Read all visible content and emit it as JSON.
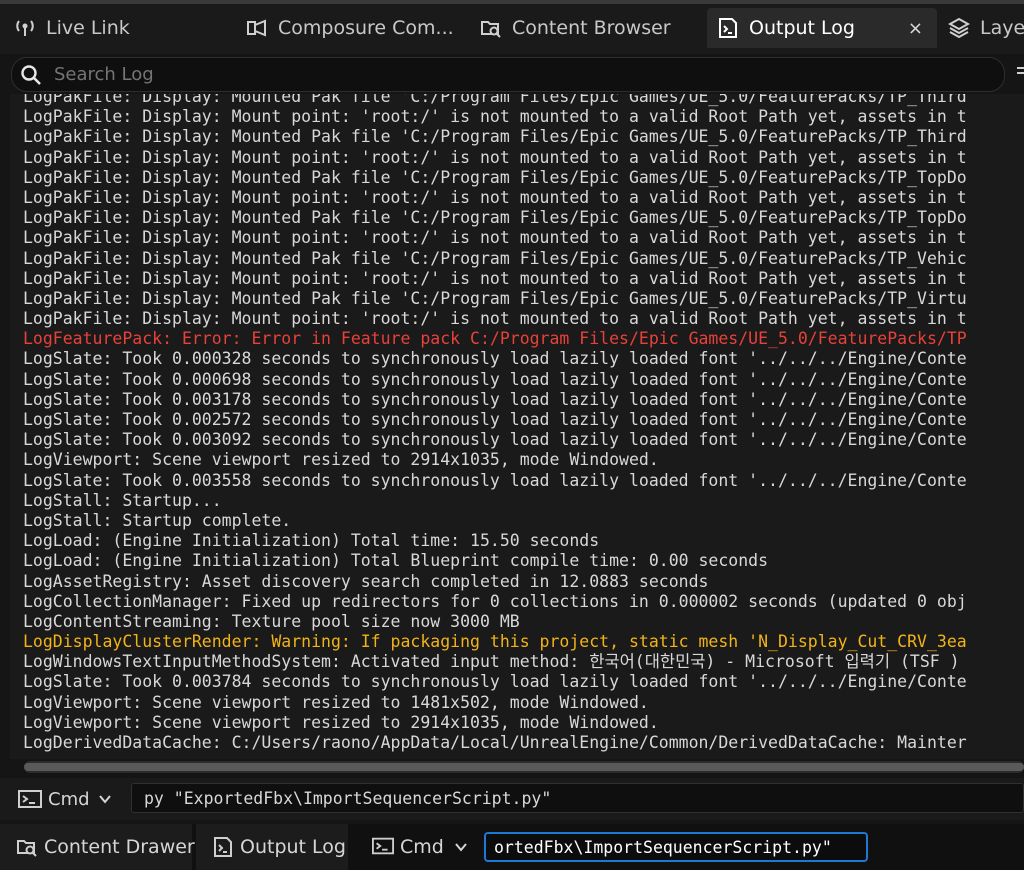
{
  "tabs": [
    {
      "label": "Live Link",
      "icon": "live-link-icon",
      "active": false
    },
    {
      "label": "Composure Com...",
      "icon": "composure-icon",
      "active": false
    },
    {
      "label": "Content Browser",
      "icon": "content-browser-icon",
      "active": false
    },
    {
      "label": "Output Log",
      "icon": "output-log-icon",
      "active": true
    },
    {
      "label": "Layer",
      "icon": "layers-icon",
      "active": false
    }
  ],
  "tab_close": "×",
  "search": {
    "placeholder": "Search Log"
  },
  "log_lines": [
    {
      "text": "LogPakFile: Display: Mounted Pak file 'C:/Program Files/Epic Games/UE_5.0/FeaturePacks/TP_Third",
      "level": "normal"
    },
    {
      "text": "LogPakFile: Display: Mount point: 'root:/' is not mounted to a valid Root Path yet, assets in t",
      "level": "normal"
    },
    {
      "text": "LogPakFile: Display: Mounted Pak file 'C:/Program Files/Epic Games/UE_5.0/FeaturePacks/TP_Third",
      "level": "normal"
    },
    {
      "text": "LogPakFile: Display: Mount point: 'root:/' is not mounted to a valid Root Path yet, assets in t",
      "level": "normal"
    },
    {
      "text": "LogPakFile: Display: Mounted Pak file 'C:/Program Files/Epic Games/UE_5.0/FeaturePacks/TP_TopDo",
      "level": "normal"
    },
    {
      "text": "LogPakFile: Display: Mount point: 'root:/' is not mounted to a valid Root Path yet, assets in t",
      "level": "normal"
    },
    {
      "text": "LogPakFile: Display: Mounted Pak file 'C:/Program Files/Epic Games/UE_5.0/FeaturePacks/TP_TopDo",
      "level": "normal"
    },
    {
      "text": "LogPakFile: Display: Mount point: 'root:/' is not mounted to a valid Root Path yet, assets in t",
      "level": "normal"
    },
    {
      "text": "LogPakFile: Display: Mounted Pak file 'C:/Program Files/Epic Games/UE_5.0/FeaturePacks/TP_Vehic",
      "level": "normal"
    },
    {
      "text": "LogPakFile: Display: Mount point: 'root:/' is not mounted to a valid Root Path yet, assets in t",
      "level": "normal"
    },
    {
      "text": "LogPakFile: Display: Mounted Pak file 'C:/Program Files/Epic Games/UE_5.0/FeaturePacks/TP_Virtu",
      "level": "normal"
    },
    {
      "text": "LogPakFile: Display: Mount point: 'root:/' is not mounted to a valid Root Path yet, assets in t",
      "level": "normal"
    },
    {
      "text": "LogFeaturePack: Error: Error in Feature pack C:/Program Files/Epic Games/UE_5.0/FeaturePacks/TP",
      "level": "error"
    },
    {
      "text": "LogSlate: Took 0.000328 seconds to synchronously load lazily loaded font '../../../Engine/Conte",
      "level": "normal"
    },
    {
      "text": "LogSlate: Took 0.000698 seconds to synchronously load lazily loaded font '../../../Engine/Conte",
      "level": "normal"
    },
    {
      "text": "LogSlate: Took 0.003178 seconds to synchronously load lazily loaded font '../../../Engine/Conte",
      "level": "normal"
    },
    {
      "text": "LogSlate: Took 0.002572 seconds to synchronously load lazily loaded font '../../../Engine/Conte",
      "level": "normal"
    },
    {
      "text": "LogSlate: Took 0.003092 seconds to synchronously load lazily loaded font '../../../Engine/Conte",
      "level": "normal"
    },
    {
      "text": "LogViewport: Scene viewport resized to 2914x1035, mode Windowed.",
      "level": "normal"
    },
    {
      "text": "LogSlate: Took 0.003558 seconds to synchronously load lazily loaded font '../../../Engine/Conte",
      "level": "normal"
    },
    {
      "text": "LogStall: Startup...",
      "level": "normal"
    },
    {
      "text": "LogStall: Startup complete.",
      "level": "normal"
    },
    {
      "text": "LogLoad: (Engine Initialization) Total time: 15.50 seconds",
      "level": "normal"
    },
    {
      "text": "LogLoad: (Engine Initialization) Total Blueprint compile time: 0.00 seconds",
      "level": "normal"
    },
    {
      "text": "LogAssetRegistry: Asset discovery search completed in 12.0883 seconds",
      "level": "normal"
    },
    {
      "text": "LogCollectionManager: Fixed up redirectors for 0 collections in 0.000002 seconds (updated 0 obj",
      "level": "normal"
    },
    {
      "text": "LogContentStreaming: Texture pool size now 3000 MB",
      "level": "normal"
    },
    {
      "text": "LogDisplayClusterRender: Warning: If packaging this project, static mesh 'N_Display_Cut_CRV_3ea",
      "level": "warning"
    },
    {
      "text": "LogWindowsTextInputMethodSystem: Activated input method: 한국어(대한민국) - Microsoft 입력기 (TSF )",
      "level": "normal"
    },
    {
      "text": "LogSlate: Took 0.003784 seconds to synchronously load lazily loaded font '../../../Engine/Conte",
      "level": "normal"
    },
    {
      "text": "LogViewport: Scene viewport resized to 1481x502, mode Windowed.",
      "level": "normal"
    },
    {
      "text": "LogViewport: Scene viewport resized to 2914x1035, mode Windowed.",
      "level": "normal"
    },
    {
      "text": "LogDerivedDataCache: C:/Users/raono/AppData/Local/UnrealEngine/Common/DerivedDataCache: Mainter",
      "level": "normal"
    }
  ],
  "cmd_row": {
    "label": "Cmd",
    "value": "py \"ExportedFbx\\ImportSequencerScript.py\""
  },
  "status_bar": {
    "content_drawer": "Content Drawer",
    "output_log": "Output Log",
    "cmd_label": "Cmd",
    "cmd_value": "ortedFbx\\ImportSequencerScript.py\""
  },
  "colors": {
    "error": "#e8413a",
    "warning": "#f2b318",
    "focus": "#1e78d6"
  }
}
